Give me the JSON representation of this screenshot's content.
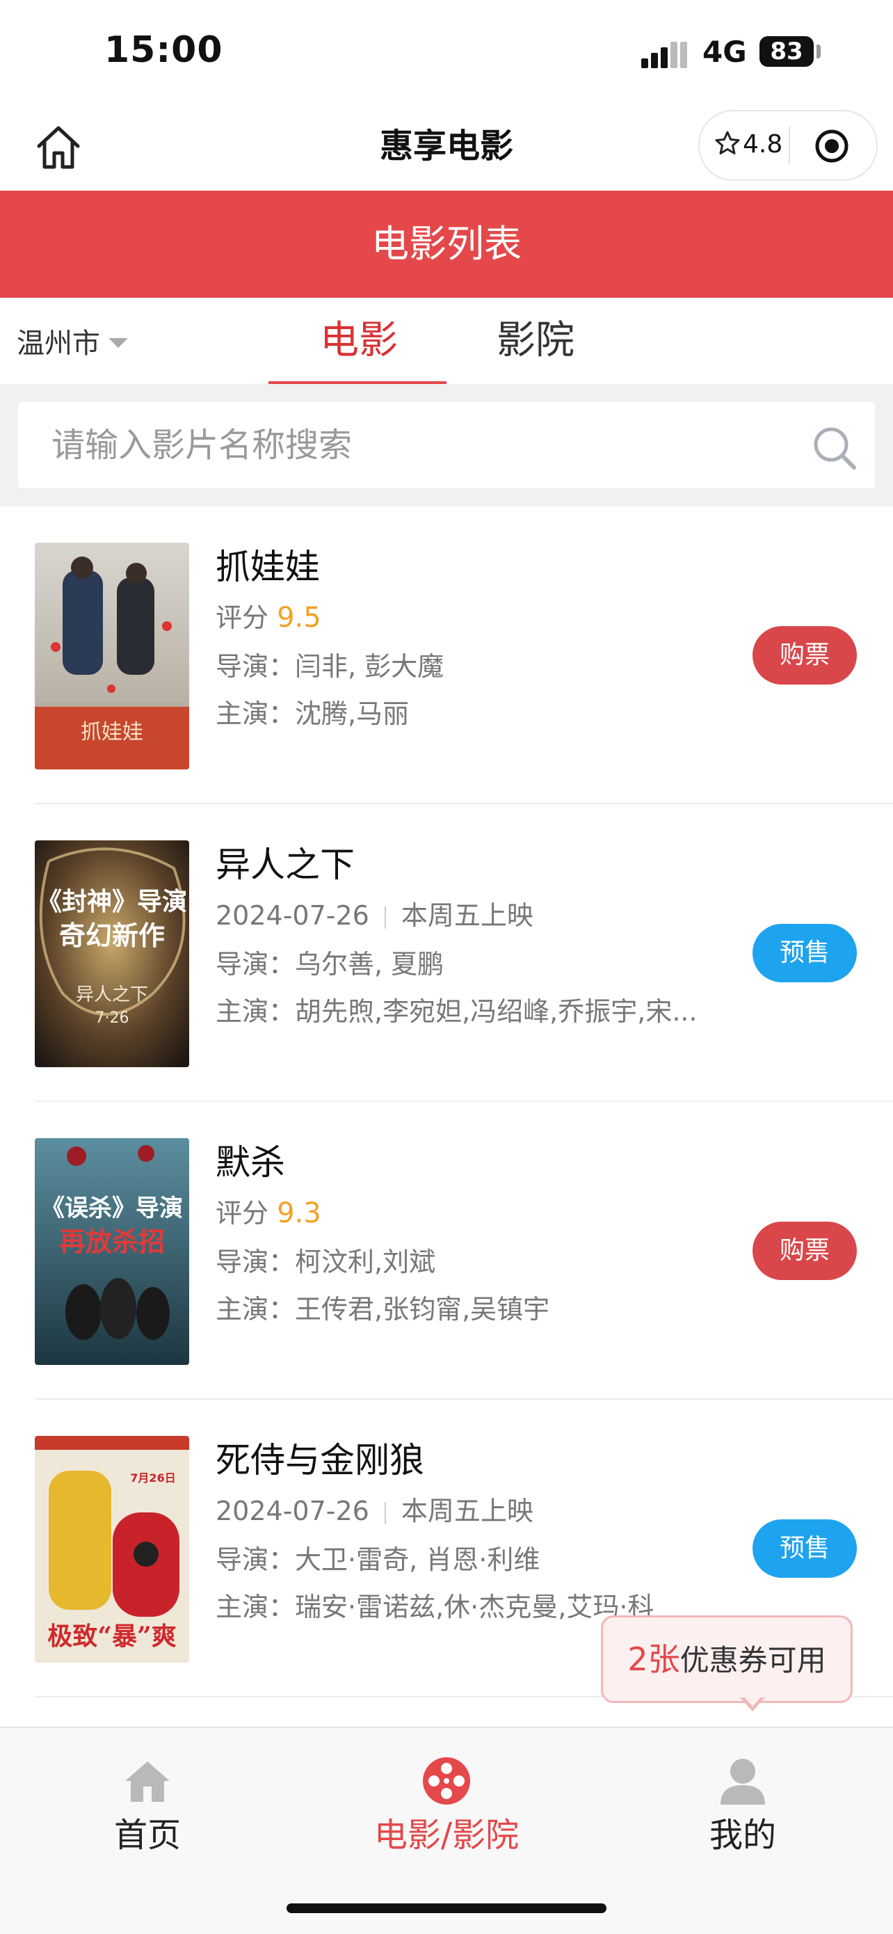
{
  "status_bar": {
    "time": "15:00",
    "network": "4G",
    "battery": "83"
  },
  "nav": {
    "title": "惠享电影",
    "rating": "4.8",
    "home_icon": "home-outline-icon",
    "target_icon": "target-icon"
  },
  "header": {
    "title": "电影列表"
  },
  "filters": {
    "city": "温州市",
    "tabs": [
      "电影",
      "影院"
    ],
    "active_tab": "电影"
  },
  "search": {
    "placeholder": "请输入影片名称搜索"
  },
  "movies": [
    {
      "title": "抓娃娃",
      "line2_label": "评分",
      "score": "9.5",
      "director_label": "导演：",
      "director": "闫非, 彭大魔",
      "cast_label": "主演：",
      "cast": "沈腾,马丽",
      "button": "购票",
      "button_type": "buy"
    },
    {
      "title": "异人之下",
      "release_date": "2024-07-26",
      "release_note": "本周五上映",
      "director_label": "导演：",
      "director": "乌尔善, 夏鹏",
      "cast_label": "主演：",
      "cast": "胡先煦,李宛妲,冯绍峰,乔振宇,宋...",
      "button": "预售",
      "button_type": "presale"
    },
    {
      "title": "默杀",
      "line2_label": "评分",
      "score": "9.3",
      "director_label": "导演：",
      "director": "柯汶利,刘斌",
      "cast_label": "主演：",
      "cast": "王传君,张钧甯,吴镇宇",
      "button": "购票",
      "button_type": "buy"
    },
    {
      "title": "死侍与金刚狼",
      "release_date": "2024-07-26",
      "release_note": "本周五上映",
      "director_label": "导演：",
      "director": "大卫·雷奇, 肖恩·利维",
      "cast_label": "主演：",
      "cast": "瑞安·雷诺兹,休·杰克曼,艾玛·科",
      "button": "预售",
      "button_type": "presale"
    }
  ],
  "posters": [
    {
      "caption": "抓娃娃"
    },
    {
      "line1": "《封神》导演",
      "line2": "奇幻新作",
      "caption": "异人之下",
      "date": "7·26"
    },
    {
      "line1": "《误杀》导演",
      "line2": "再放杀招"
    },
    {
      "line1": "极致“暴”爽",
      "date": "7月26日"
    }
  ],
  "coupon": {
    "count": "2张",
    "text": "优惠券可用"
  },
  "tabbar": [
    {
      "label": "首页",
      "icon": "home-icon",
      "active": false
    },
    {
      "label": "电影/影院",
      "icon": "film-reel-icon",
      "active": true
    },
    {
      "label": "我的",
      "icon": "user-icon",
      "active": false
    }
  ],
  "colors": {
    "brand_red": "#e4484a",
    "presale_blue": "#1ea3ef",
    "score_orange": "#f3a126"
  }
}
